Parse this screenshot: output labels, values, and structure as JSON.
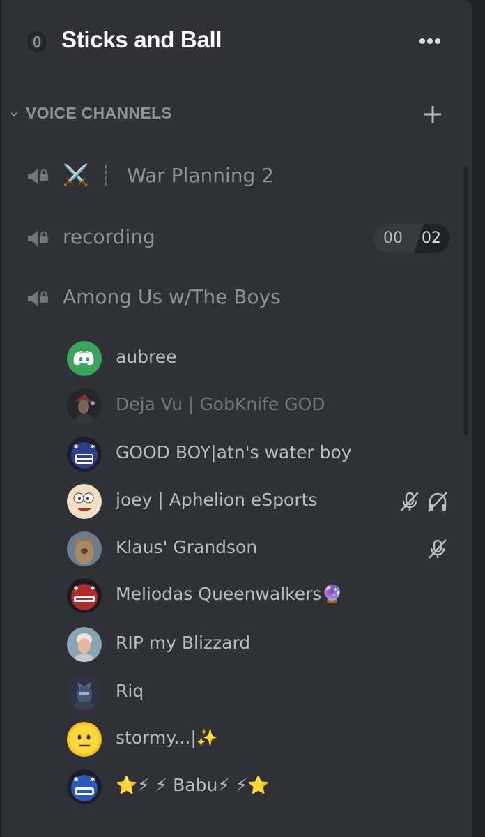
{
  "server": {
    "name": "Sticks and Ball",
    "icon": "server-settings-icon"
  },
  "category": {
    "label": "VOICE CHANNELS"
  },
  "channels": [
    {
      "emoji": "⚔️",
      "separator": "┊",
      "name": "War Planning 2"
    },
    {
      "name": "recording",
      "user_count": "00",
      "user_limit": "02"
    },
    {
      "name": "Among Us w/The Boys"
    }
  ],
  "members": [
    {
      "name": "aubree",
      "avatar": "discord-logo-avatar",
      "dimmed": false
    },
    {
      "name": "Deja Vu | GobKnife GOD",
      "avatar": "photo-avatar",
      "dimmed": true
    },
    {
      "name": "GOOD BOY|atn's water boy",
      "avatar": "good-boy-badge-avatar",
      "dimmed": false
    },
    {
      "name": "joey | Aphelion eSports",
      "avatar": "cartoon-face-avatar",
      "muted": true,
      "deafened": true
    },
    {
      "name": "Klaus' Grandson",
      "avatar": "bear-photo-avatar",
      "muted": true
    },
    {
      "name": "Meliodas Queenwalkers🔮",
      "avatar": "meliodas-badge-avatar"
    },
    {
      "name": "RIP my Blizzard",
      "avatar": "person-photo-avatar"
    },
    {
      "name": "Riq",
      "avatar": "robot-photo-avatar"
    },
    {
      "name": "stormy...|✨",
      "avatar": "emoji-face-avatar"
    },
    {
      "name": "⭐⚡ ⚡ Babu⚡ ⚡⭐",
      "avatar": "babu-badge-avatar"
    }
  ],
  "colors": {
    "background": "#2f3136",
    "outer": "#202225",
    "channel_text": "#8e9297",
    "member_text": "#b9bbbe",
    "blurple": "#5865f2",
    "green_avatar": "#3ba55d"
  }
}
